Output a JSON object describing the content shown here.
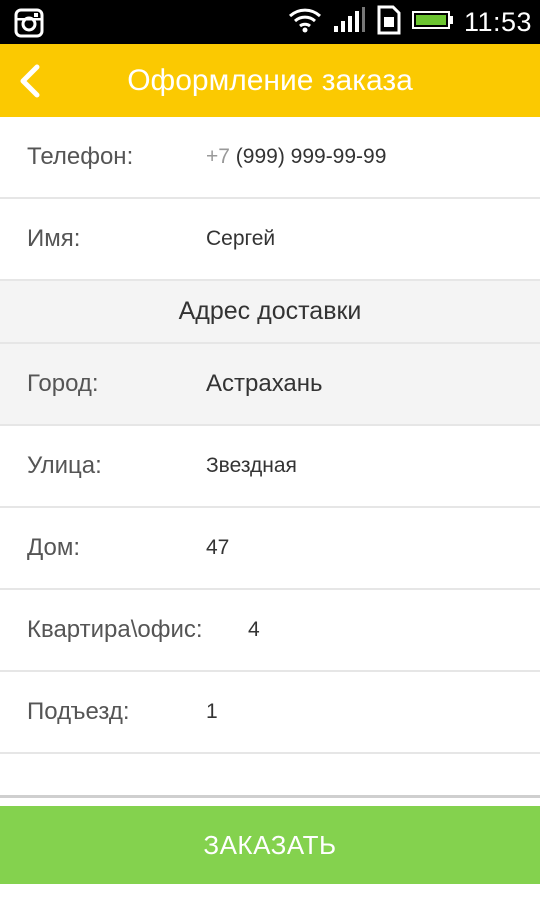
{
  "status_bar": {
    "time": "11:53",
    "icons": [
      "instagram-icon",
      "wifi-icon",
      "signal-icon",
      "sim-icon",
      "battery-icon"
    ]
  },
  "header": {
    "title": "Оформление заказа",
    "back_icon": "chevron-left-icon",
    "color": "#fbc901"
  },
  "form": {
    "phone": {
      "label": "Телефон:",
      "prefix": "+7",
      "value": "(999) 999-99-99"
    },
    "name": {
      "label": "Имя:",
      "value": "Сергей"
    }
  },
  "delivery": {
    "section_title": "Адрес доставки",
    "city": {
      "label": "Город:",
      "value": "Астрахань"
    },
    "street": {
      "label": "Улица:",
      "value": "Звездная"
    },
    "house": {
      "label": "Дом:",
      "value": "47"
    },
    "apartment": {
      "label": "Квартира\\офис:",
      "value": "4"
    },
    "entrance": {
      "label": "Подъезд:",
      "value": "1"
    }
  },
  "order_button": {
    "label": "ЗАКАЗАТЬ",
    "color": "#84d24e"
  }
}
